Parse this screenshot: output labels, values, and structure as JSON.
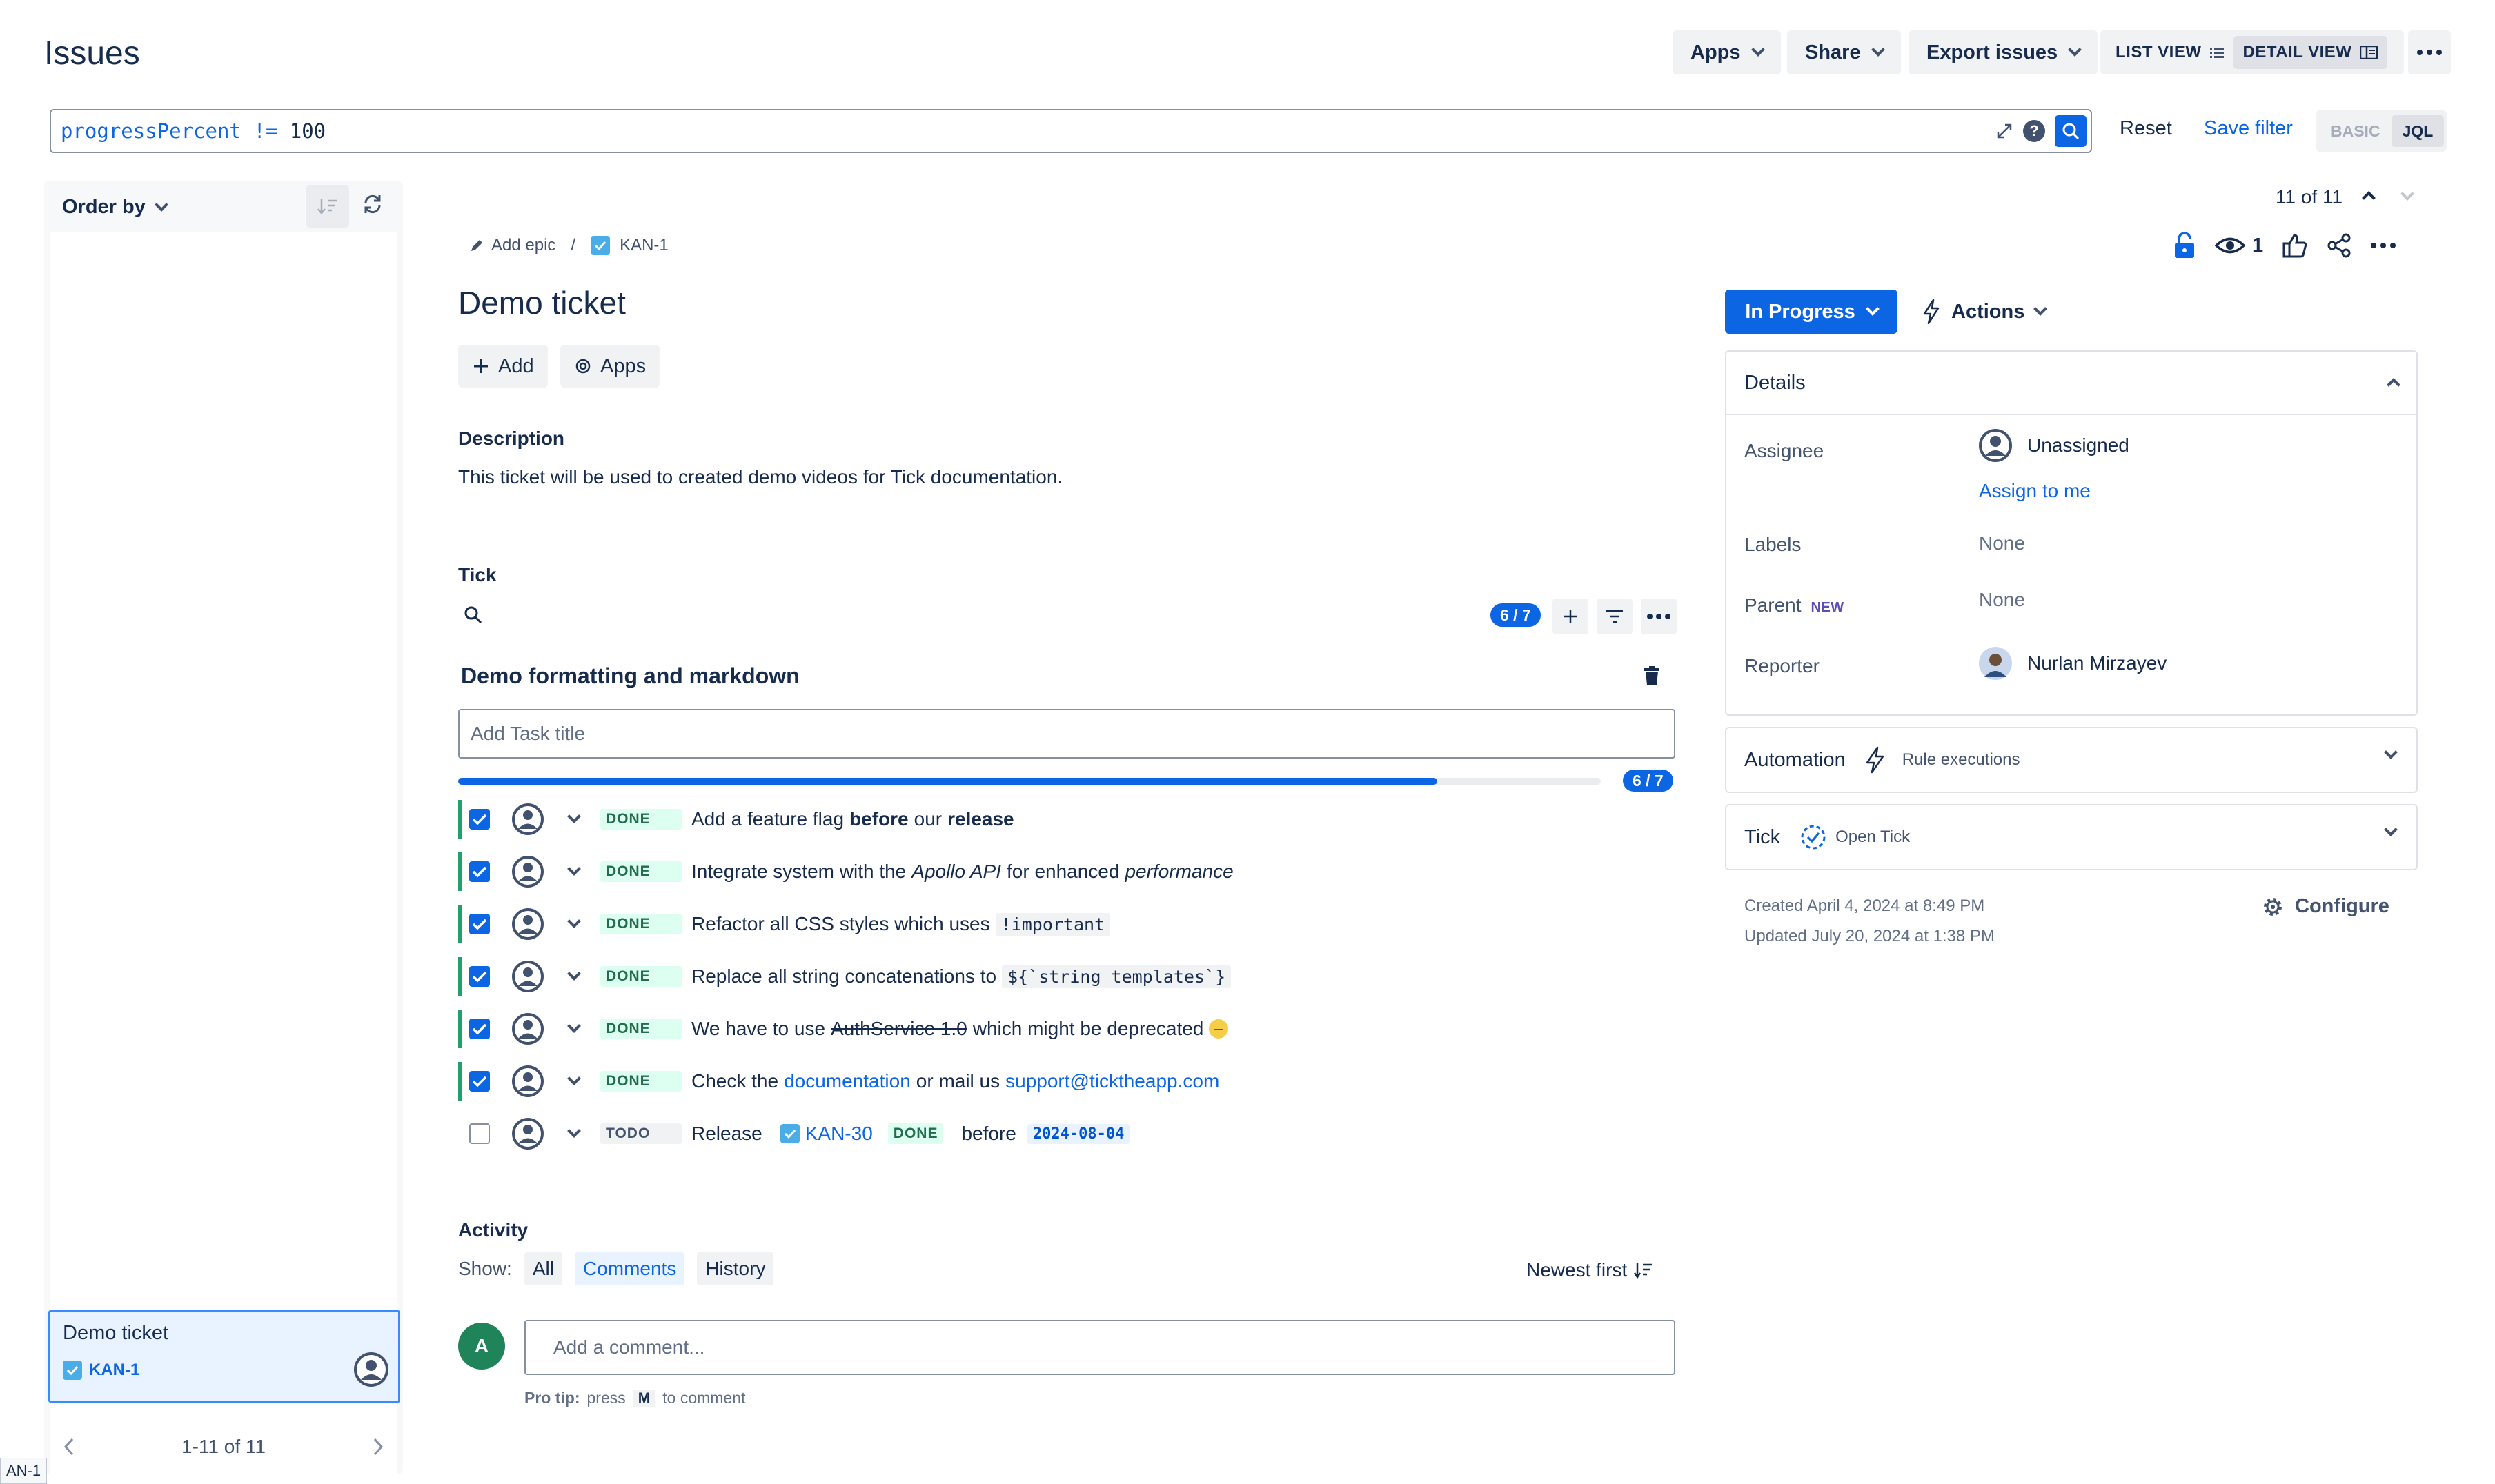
{
  "header": {
    "title": "Issues",
    "apps_label": "Apps",
    "share_label": "Share",
    "export_label": "Export issues",
    "list_view_label": "LIST VIEW",
    "detail_view_label": "DETAIL VIEW"
  },
  "jql": {
    "field": "progressPercent",
    "operator": "!=",
    "value": "100",
    "reset_label": "Reset",
    "save_filter_label": "Save filter",
    "basic_label": "BASIC",
    "jql_label": "JQL"
  },
  "sidebar": {
    "order_by_label": "Order by",
    "items": [
      {
        "title": "Demo ticket",
        "key": "KAN-1"
      }
    ],
    "pager_text": "1-11 of 11"
  },
  "issue": {
    "breadcrumb_epic": "Add epic",
    "breadcrumb_key": "KAN-1",
    "title": "Demo ticket",
    "add_label": "Add",
    "apps_label": "Apps",
    "description_heading": "Description",
    "description_text": "This ticket will be used to created demo videos for Tick documentation."
  },
  "tick": {
    "heading": "Tick",
    "count": "6 / 7",
    "progress_fraction": 0.857,
    "list_title": "Demo formatting and markdown",
    "task_placeholder": "Add Task title",
    "tasks": [
      {
        "status": "DONE",
        "parts": [
          "Add a feature flag ",
          "before",
          " our ",
          "release"
        ]
      },
      {
        "status": "DONE",
        "parts": [
          "Integrate system with the ",
          "Apollo API",
          " for enhanced ",
          "performance"
        ]
      },
      {
        "status": "DONE",
        "parts": [
          "Refactor all CSS styles which uses ",
          "!important"
        ]
      },
      {
        "status": "DONE",
        "parts": [
          "Replace all string concatenations to ",
          "${`string templates`}"
        ]
      },
      {
        "status": "DONE",
        "parts": [
          "We have to use ",
          "AuthService 1.0",
          " which might be deprecated"
        ]
      },
      {
        "status": "DONE",
        "parts": [
          "Check the ",
          "documentation",
          " or mail us ",
          "support@ticktheapp.com"
        ]
      },
      {
        "status": "TODO",
        "parts": [
          "Release",
          "KAN-30",
          "DONE",
          "before",
          "2024-08-04"
        ]
      }
    ]
  },
  "activity": {
    "heading": "Activity",
    "show_label": "Show:",
    "filters": [
      "All",
      "Comments",
      "History"
    ],
    "sort_label": "Newest first",
    "user_initial": "A",
    "comment_placeholder": "Add a comment...",
    "protip_label": "Pro tip:",
    "protip_press": "press",
    "protip_key": "M",
    "protip_rest": "to comment"
  },
  "right": {
    "nav_count": "11 of 11",
    "watchers": "1",
    "status_label": "In Progress",
    "actions_label": "Actions",
    "details_heading": "Details",
    "assignee_label": "Assignee",
    "assignee_value": "Unassigned",
    "assign_to_me": "Assign to me",
    "labels_label": "Labels",
    "labels_value": "None",
    "parent_label": "Parent",
    "parent_badge": "NEW",
    "parent_value": "None",
    "reporter_label": "Reporter",
    "reporter_value": "Nurlan Mirzayev",
    "automation_label": "Automation",
    "automation_sub": "Rule executions",
    "tick_label": "Tick",
    "tick_sub": "Open Tick",
    "created": "Created April 4, 2024 at 8:49 PM",
    "updated": "Updated July 20, 2024 at 1:38 PM",
    "configure_label": "Configure"
  },
  "corner_tag": "AN-1",
  "colors": {
    "accent": "#0c66e4",
    "done_bg": "#dcfff1",
    "done_text": "#216e4e",
    "selected_card": "#e9f2ff"
  }
}
